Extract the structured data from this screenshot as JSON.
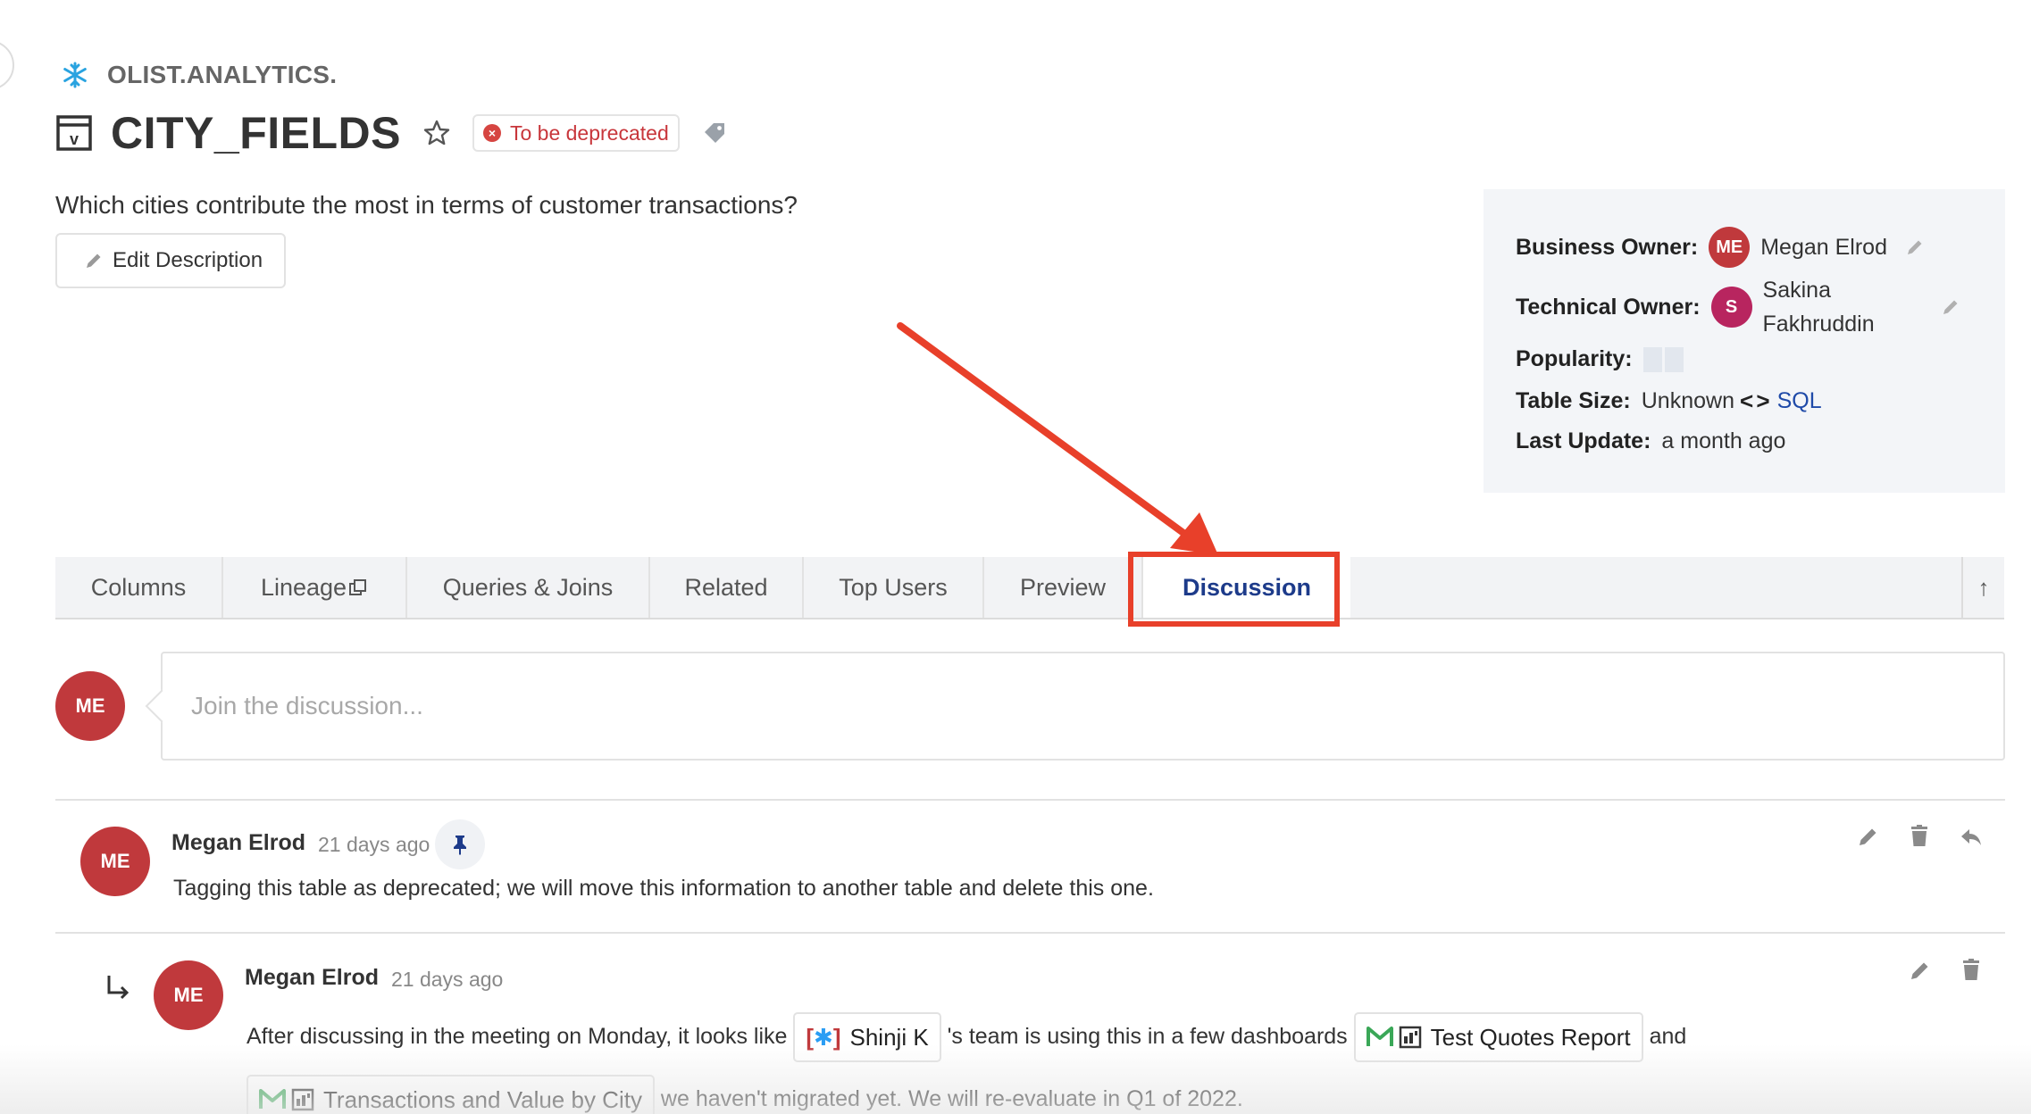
{
  "breadcrumb": {
    "schema": "OLIST.ANALYTICS."
  },
  "table": {
    "title": "CITY_FIELDS",
    "status_badge": "To be deprecated",
    "description": "Which cities contribute the most in terms of customer transactions?",
    "edit_description_label": "Edit Description"
  },
  "owners": {
    "business_owner_label": "Business Owner:",
    "business_owner_initials": "ME",
    "business_owner_name": "Megan Elrod",
    "technical_owner_label": "Technical Owner:",
    "technical_owner_initials": "S",
    "technical_owner_name_line1": "Sakina",
    "technical_owner_name_line2": "Fakhruddin",
    "popularity_label": "Popularity:",
    "table_size_label": "Table Size:",
    "table_size_value": "Unknown",
    "sql_link": "SQL",
    "last_update_label": "Last Update:",
    "last_update_value": "a month ago"
  },
  "tabs": [
    {
      "label": "Columns"
    },
    {
      "label": "Lineage"
    },
    {
      "label": "Queries & Joins"
    },
    {
      "label": "Related"
    },
    {
      "label": "Top Users"
    },
    {
      "label": "Preview"
    },
    {
      "label": "Discussion",
      "active": true
    }
  ],
  "tabs_up_glyph": "↑",
  "discussion": {
    "current_user_initials": "ME",
    "placeholder": "Join the discussion...",
    "comments": [
      {
        "initials": "ME",
        "author": "Megan Elrod",
        "time": "21 days ago",
        "text": "Tagging this table as deprecated; we will move this information to another table and delete this one."
      },
      {
        "initials": "ME",
        "author": "Megan Elrod",
        "time": "21 days ago",
        "text_part1": "After discussing in the meeting on Monday, it looks like",
        "mention_user": "Shinji K",
        "text_part2": "'s team is using this in a few dashboards",
        "dashboard1": "Test Quotes Report",
        "text_part3": "and",
        "dashboard2": "Transactions and Value by City",
        "text_part4": "we haven't migrated yet. We will re-evaluate in Q1 of 2022."
      }
    ]
  },
  "colors": {
    "accent_blue": "#1d3b8a",
    "annotation_red": "#e8402a",
    "avatar_red": "#c0393c",
    "avatar_magenta": "#b8255f",
    "deprecated_red": "#c8363b"
  }
}
